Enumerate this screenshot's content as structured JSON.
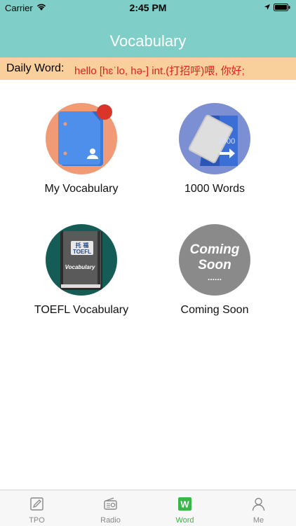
{
  "status_bar": {
    "carrier": "Carrier",
    "time": "2:45 PM"
  },
  "nav": {
    "title": "Vocabulary"
  },
  "daily_word": {
    "label": "Daily Word:",
    "text": "hello [hɛˈlo, hə-] int.(打招呼)喂, 你好;"
  },
  "tiles": [
    {
      "caption": "My Vocabulary",
      "icon": "notebook-user-icon",
      "color": "#f19a76"
    },
    {
      "caption": "1000 Words",
      "icon": "flashcards-1000-icon",
      "color": "#7c8fd3",
      "icon_text": "1000"
    },
    {
      "caption": "TOEFL Vocabulary",
      "icon": "toefl-book-icon",
      "color": "#145c55",
      "book_title": "托 福",
      "book_subtitle": "TOEFL",
      "book_label": "Vocabulary"
    },
    {
      "caption": "Coming Soon",
      "icon": "coming-soon-icon",
      "color": "#8a8a8a",
      "icon_line1": "Coming",
      "icon_line2": "Soon",
      "icon_line3": "......"
    }
  ],
  "tabbar": {
    "active_color": "#3bb54a",
    "items": [
      {
        "label": "TPO",
        "icon": "edit-icon"
      },
      {
        "label": "Radio",
        "icon": "radio-icon"
      },
      {
        "label": "Word",
        "icon": "word-w-icon",
        "active": true,
        "icon_text": "W"
      },
      {
        "label": "Me",
        "icon": "person-icon"
      }
    ]
  }
}
